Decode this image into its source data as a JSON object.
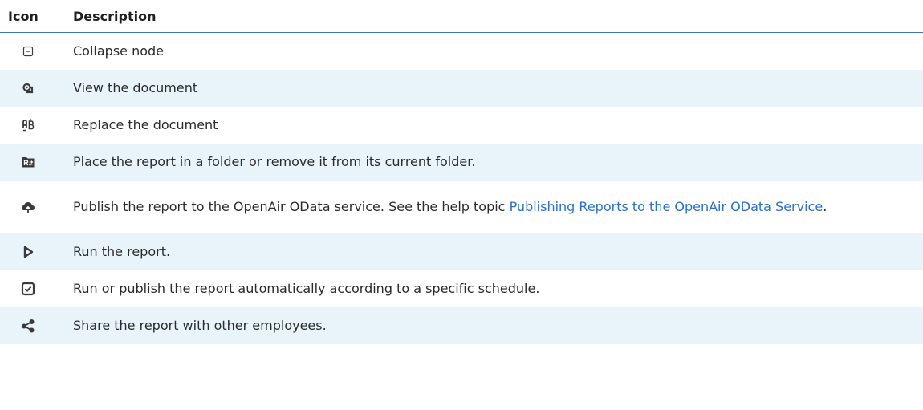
{
  "header": {
    "icon_col": "Icon",
    "desc_col": "Description"
  },
  "rows": [
    {
      "icon": "collapse-node-icon",
      "text": "Collapse node"
    },
    {
      "icon": "view-document-icon",
      "text": "View the document"
    },
    {
      "icon": "replace-document-icon",
      "text": "Replace the document"
    },
    {
      "icon": "report-folder-icon",
      "text": "Place the report in a folder or remove it from its current folder."
    },
    {
      "icon": "publish-odata-icon",
      "text": "Publish the report to the OpenAir OData service. See the help topic ",
      "link": "Publishing Reports to the OpenAir OData Service",
      "after": "."
    },
    {
      "icon": "run-report-icon",
      "text": "Run the report."
    },
    {
      "icon": "schedule-report-icon",
      "text": "Run or publish the report automatically according to a specific schedule."
    },
    {
      "icon": "share-report-icon",
      "text": "Share the report with other employees."
    }
  ],
  "colors": {
    "header_rule": "#3c74b5",
    "stripe": "#e8f4fa",
    "link": "#2a6fc9",
    "icon": "#3a3a3a"
  }
}
